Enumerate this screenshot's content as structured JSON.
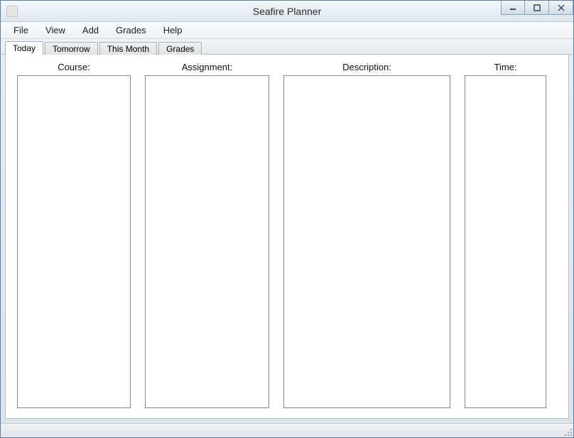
{
  "window": {
    "title": "Seafire Planner"
  },
  "menubar": {
    "items": [
      {
        "label": "File"
      },
      {
        "label": "View"
      },
      {
        "label": "Add"
      },
      {
        "label": "Grades"
      },
      {
        "label": "Help"
      }
    ]
  },
  "tabs": {
    "items": [
      {
        "label": "Today",
        "active": true
      },
      {
        "label": "Tomorrow",
        "active": false
      },
      {
        "label": "This Month",
        "active": false
      },
      {
        "label": "Grades",
        "active": false
      }
    ]
  },
  "columns": {
    "course": {
      "header": "Course:"
    },
    "assignment": {
      "header": "Assignment:"
    },
    "description": {
      "header": "Description:"
    },
    "time": {
      "header": "Time:"
    }
  }
}
